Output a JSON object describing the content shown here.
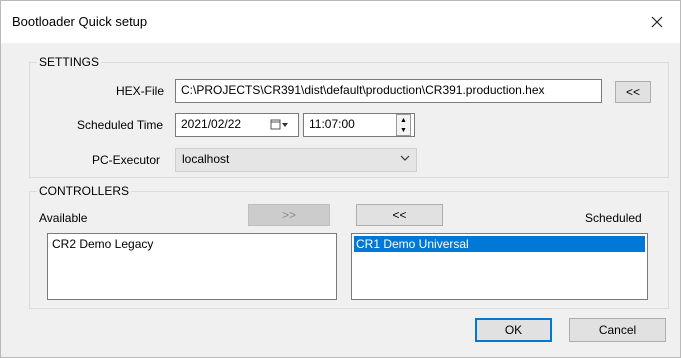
{
  "window": {
    "title": "Bootloader Quick setup"
  },
  "settings": {
    "group_label": "SETTINGS",
    "hex_file_label": "HEX-File",
    "hex_file_value": "C:\\PROJECTS\\CR391\\dist\\default\\production\\CR391.production.hex",
    "browse_label": "<<",
    "scheduled_time_label": "Scheduled Time",
    "date_value": "2021/02/22",
    "time_value": "11:07:00",
    "pc_executor_label": "PC-Executor",
    "pc_executor_value": "localhost"
  },
  "controllers": {
    "group_label": "CONTROLLERS",
    "available_label": "Available",
    "scheduled_label": "Scheduled",
    "move_right_label": ">>",
    "move_left_label": "<<",
    "available_items": [
      "CR2 Demo Legacy"
    ],
    "scheduled_items": [
      "CR1 Demo Universal"
    ]
  },
  "footer": {
    "ok_label": "OK",
    "cancel_label": "Cancel"
  },
  "colors": {
    "selection": "#0078d7",
    "window_bg": "#f0f0f0",
    "titlebar_bg": "#ffffff"
  }
}
